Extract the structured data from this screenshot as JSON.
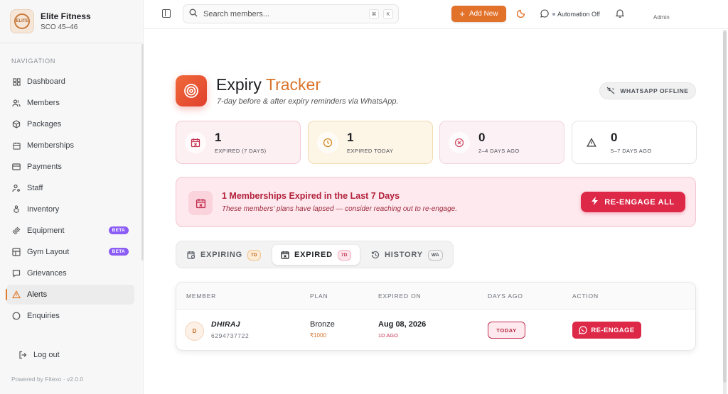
{
  "brand": {
    "name": "Elite Fitness",
    "subtitle": "SCO 45–46",
    "logo_text": "ELITE"
  },
  "sidebar": {
    "heading": "NAVIGATION",
    "items": [
      {
        "label": "Dashboard",
        "icon": "grid-icon"
      },
      {
        "label": "Members",
        "icon": "users-icon"
      },
      {
        "label": "Packages",
        "icon": "package-icon"
      },
      {
        "label": "Memberships",
        "icon": "calendar-icon"
      },
      {
        "label": "Payments",
        "icon": "credit-card-icon"
      },
      {
        "label": "Staff",
        "icon": "user-cog-icon"
      },
      {
        "label": "Inventory",
        "icon": "boxes-icon"
      },
      {
        "label": "Equipment",
        "icon": "dumbbell-icon",
        "badge": "BETA"
      },
      {
        "label": "Gym Layout",
        "icon": "layout-icon",
        "badge": "BETA"
      },
      {
        "label": "Grievances",
        "icon": "message-icon"
      },
      {
        "label": "Alerts",
        "icon": "alert-triangle-icon",
        "active": true
      },
      {
        "label": "Enquiries",
        "icon": "chat-icon"
      }
    ],
    "logout": "Log out",
    "powered_by": "Powered by Fitexo · v2.0.0"
  },
  "topbar": {
    "search_placeholder": "Search members...",
    "kbd_1": "⌘",
    "kbd_2": "K",
    "add_new": "Add New",
    "automation": "Automation Off",
    "user": "Admin"
  },
  "header": {
    "title_main": "Expiry",
    "title_accent": "Tracker",
    "subtitle": "7-day before & after expiry reminders via WhatsApp.",
    "wa_status": "WHATSAPP OFFLINE"
  },
  "stats": [
    {
      "value": "1",
      "label": "EXPIRED (7 DAYS)"
    },
    {
      "value": "1",
      "label": "EXPIRED TODAY"
    },
    {
      "value": "0",
      "label": "2–4 DAYS AGO"
    },
    {
      "value": "0",
      "label": "5–7 DAYS AGO"
    }
  ],
  "banner": {
    "title": "1 Memberships Expired in the Last 7 Days",
    "subtitle": "These members' plans have lapsed — consider reaching out to re-engage.",
    "button": "RE-ENGAGE ALL"
  },
  "tabs": [
    {
      "label": "EXPIRING",
      "badge": "7D"
    },
    {
      "label": "EXPIRED",
      "badge": "7D",
      "active": true
    },
    {
      "label": "HISTORY",
      "badge": "WA"
    }
  ],
  "table": {
    "columns": [
      "MEMBER",
      "PLAN",
      "EXPIRED ON",
      "DAYS AGO",
      "ACTION"
    ],
    "rows": [
      {
        "initial": "D",
        "name": "DHIRAJ",
        "phone": "6294737722",
        "plan": "Bronze",
        "price": "₹1000",
        "expired_on": "Aug 08, 2026",
        "ago": "1D AGO",
        "days_badge": "TODAY",
        "action": "RE-ENGAGE"
      }
    ]
  },
  "colors": {
    "accent": "#e2712a",
    "danger": "#dd2848",
    "beta": "#8b5cf6"
  }
}
